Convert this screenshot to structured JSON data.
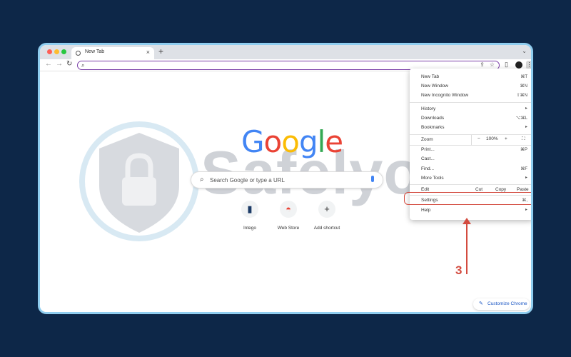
{
  "window": {
    "tab_title": "New Tab",
    "tab_close": "×",
    "new_tab": "+",
    "tab_menu": "⌄",
    "traffic_lights": [
      "#ff5f57",
      "#febc2e",
      "#28c840"
    ]
  },
  "toolbar": {
    "back": "←",
    "forward": "→",
    "reload": "↻",
    "address_value": "",
    "share_icon": "⇪",
    "star_icon": "☆",
    "sidepanel_icon": "▯",
    "menu_icon": "⋮"
  },
  "page": {
    "logo": [
      {
        "ch": "G",
        "color": "#4285f4"
      },
      {
        "ch": "o",
        "color": "#ea4335"
      },
      {
        "ch": "o",
        "color": "#fbbc05"
      },
      {
        "ch": "g",
        "color": "#4285f4"
      },
      {
        "ch": "l",
        "color": "#34a853"
      },
      {
        "ch": "e",
        "color": "#ea4335"
      }
    ],
    "search_placeholder": "Search Google or type a URL",
    "shortcuts": [
      {
        "label": "Intego",
        "icon": "▮"
      },
      {
        "label": "Web Store",
        "icon": "◓"
      },
      {
        "label": "Add shortcut",
        "icon": "+"
      }
    ],
    "customize_label": "Customize Chrome"
  },
  "menu": {
    "new_tab": {
      "label": "New Tab",
      "shortcut": "⌘T"
    },
    "new_window": {
      "label": "New Window",
      "shortcut": "⌘N"
    },
    "new_incognito": {
      "label": "New Incognito Window",
      "shortcut": "⇧⌘N"
    },
    "history": {
      "label": "History",
      "arrow": "▸"
    },
    "downloads": {
      "label": "Downloads",
      "shortcut": "⌥⌘L"
    },
    "bookmarks": {
      "label": "Bookmarks",
      "arrow": "▸"
    },
    "zoom": {
      "label": "Zoom",
      "minus": "−",
      "value": "100%",
      "plus": "+",
      "fullscreen": "⛶"
    },
    "print": {
      "label": "Print...",
      "shortcut": "⌘P"
    },
    "cast": {
      "label": "Cast..."
    },
    "find": {
      "label": "Find...",
      "shortcut": "⌘F"
    },
    "more_tools": {
      "label": "More Tools",
      "arrow": "▸"
    },
    "edit": {
      "label": "Edit",
      "cut": "Cut",
      "copy": "Copy",
      "paste": "Paste"
    },
    "settings": {
      "label": "Settings",
      "shortcut": "⌘,"
    },
    "help": {
      "label": "Help",
      "arrow": "▸"
    }
  },
  "annotation": {
    "step_number": "3",
    "highlight_color": "#d34b3f"
  },
  "watermark": {
    "text": "Safelyo"
  },
  "colors": {
    "background": "#0d2748",
    "window_border": "#8fcdef",
    "address_focus": "#7b3fa8",
    "link_blue": "#1a56c4"
  }
}
